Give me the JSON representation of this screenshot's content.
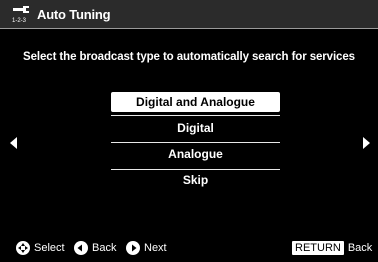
{
  "header": {
    "title": "Auto Tuning",
    "icon_label": "1-2-3",
    "icon": "wrench-icon"
  },
  "instruction": "Select the broadcast type to automatically search for services",
  "options": [
    {
      "label": "Digital and Analogue",
      "selected": true
    },
    {
      "label": "Digital",
      "selected": false
    },
    {
      "label": "Analogue",
      "selected": false
    },
    {
      "label": "Skip",
      "selected": false
    }
  ],
  "nav": {
    "left_icon": "arrow-left-icon",
    "right_icon": "arrow-right-icon"
  },
  "footer": {
    "select_label": "Select",
    "back_label": "Back",
    "next_label": "Next",
    "return_key": "RETURN",
    "return_label": "Back"
  },
  "colors": {
    "background": "#000000",
    "header": "#2b2b2b",
    "selected": "#ffffff"
  }
}
